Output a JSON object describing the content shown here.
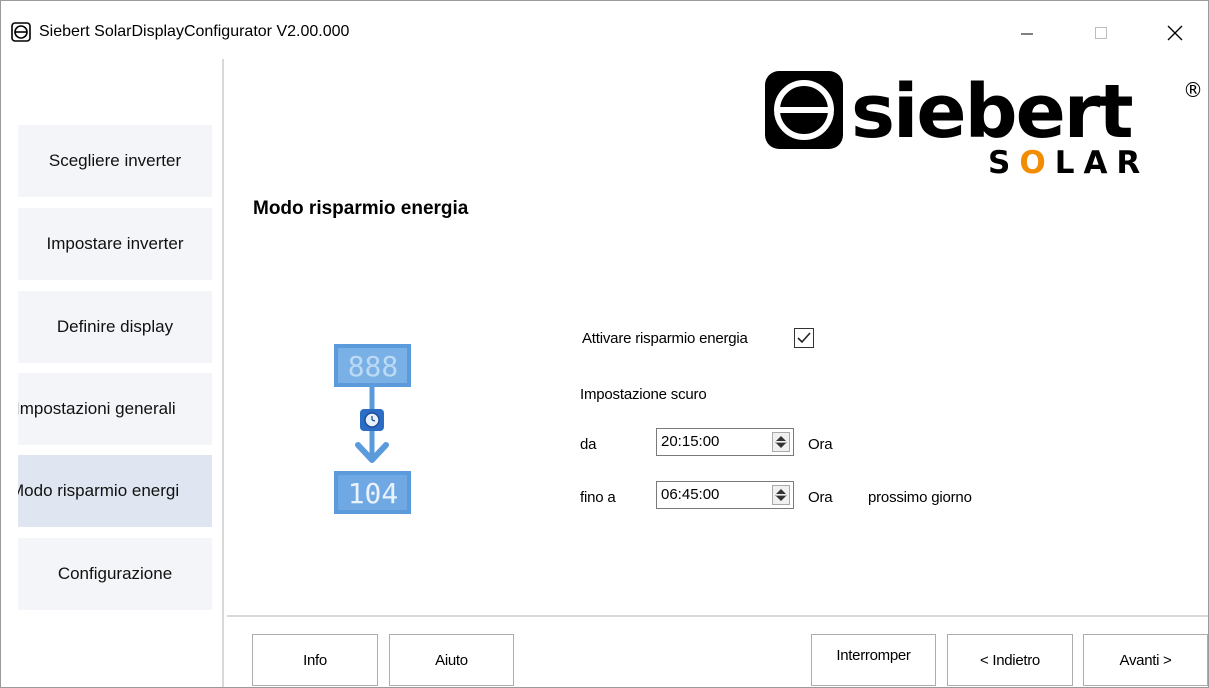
{
  "window": {
    "title": "Siebert SolarDisplayConfigurator V2.00.000",
    "controls": {
      "minimize": "—",
      "maximize": "☐",
      "close": "✕"
    }
  },
  "sidebar": {
    "items": [
      {
        "label": "Scegliere inverter"
      },
      {
        "label": "Impostare inverter"
      },
      {
        "label": "Definire display"
      },
      {
        "label": "Impostazioni generali"
      },
      {
        "label": "Modo risparmio energi",
        "active": true
      },
      {
        "label": "Configurazione"
      }
    ]
  },
  "logo": {
    "brand": "siebert",
    "registered": "®",
    "sub": "SOLAR",
    "icon": "siebert-logo-icon"
  },
  "main": {
    "title": "Modo risparmio energia",
    "illustration": {
      "top_display": "888",
      "bottom_display": "104",
      "icon": "clock-icon"
    },
    "enable_label": "Attivare risparmio energia",
    "enable_checked": true,
    "dark_setting_label": "Impostazione scuro",
    "from": {
      "label": "da",
      "value": "20:15:00",
      "unit": "Ora"
    },
    "to": {
      "label": "fino a",
      "value": "06:45:00",
      "unit": "Ora",
      "note": "prossimo giorno"
    }
  },
  "buttons": {
    "info": "Info",
    "help": "Aiuto",
    "abort": "Interromper",
    "back": "< Indietro",
    "next": "Avanti >"
  },
  "colors": {
    "active_nav": "#dfe6f1",
    "nav": "#f3f5f8",
    "display_blue": "#5b9bdc",
    "logo": "#000000",
    "logo_accent": "#f28c00"
  }
}
